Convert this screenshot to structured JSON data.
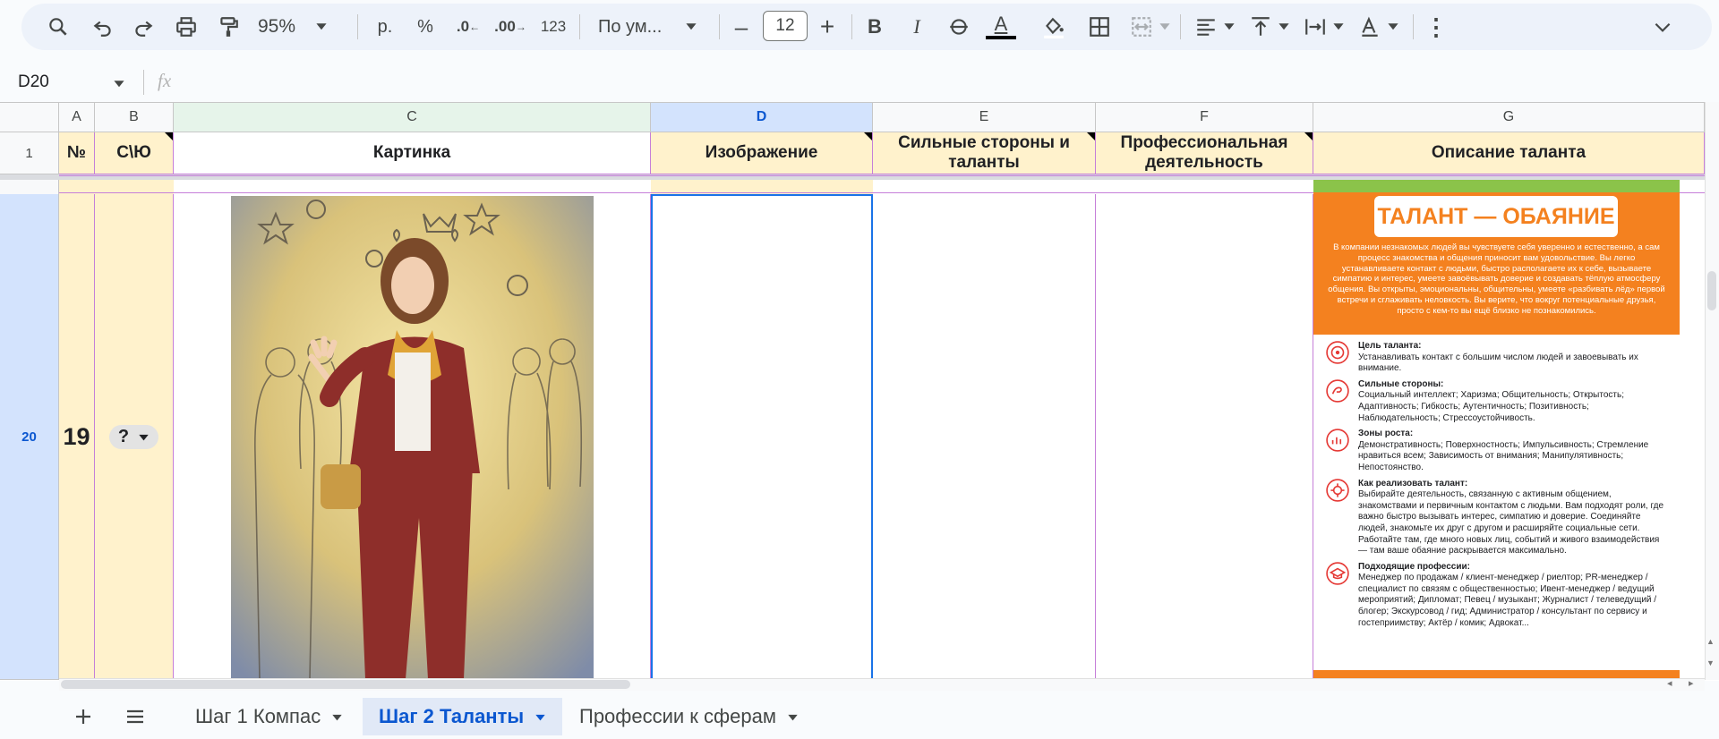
{
  "toolbar": {
    "zoom": "95%",
    "currency": "р.",
    "percent": "%",
    "dec_less": ".0",
    "dec_more": ".00",
    "number_format": "123",
    "font_name": "По ум...",
    "font_size": "12",
    "minus": "–",
    "plus": "+",
    "bold": "B",
    "italic": "I",
    "text_color": "A",
    "more": "⋮"
  },
  "formula_bar": {
    "cell_ref": "D20",
    "fx": "fx",
    "value": ""
  },
  "columns": [
    "A",
    "B",
    "C",
    "D",
    "E",
    "F",
    "G"
  ],
  "header_row": {
    "row_number": "1",
    "cells": [
      "№",
      "С\\Ю",
      "Картинка",
      "Изображение",
      "Сильные стороны и таланты",
      "Профессиональная деятельность",
      "Описание таланта"
    ]
  },
  "row20": {
    "row_number": "20",
    "num": "19",
    "chip": "?"
  },
  "talent_card": {
    "title": "ТАЛАНТ — ОБАЯНИЕ",
    "intro": "В компании незнакомых людей вы чувствуете себя уверенно и естественно, а сам процесс знакомства и общения приносит вам удовольствие. Вы легко устанавливаете контакт с людьми, быстро располагаете их к себе, вызываете симпатию и интерес, умеете завоёвывать доверие и создавать тёплую атмосферу общения. Вы открыты, эмоциональны, общительны, умеете «разбивать лёд» первой встречи и сглаживать неловкость. Вы верите, что вокруг потенциальные друзья, просто с кем-то вы ещё близко не познакомились.",
    "sections": [
      {
        "heading": "Цель таланта:",
        "text": "Устанавливать контакт с большим числом людей и завоевывать их внимание."
      },
      {
        "heading": "Сильные стороны:",
        "text": "Социальный интеллект; Харизма; Общительность; Открытость; Адаптивность; Гибкость; Аутентичность; Позитивность; Наблюдательность; Стрессоустойчивость."
      },
      {
        "heading": "Зоны роста:",
        "text": "Демонстративность; Поверхностность; Импульсивность; Стремление нравиться всем; Зависимость от внимания; Манипулятивность; Непостоянство."
      },
      {
        "heading": "Как реализовать талант:",
        "text": "Выбирайте деятельность, связанную с активным общением, знакомствами и первичным контактом с людьми. Вам подходят роли, где важно быстро вызывать интерес, симпатию и доверие. Соединяйте людей, знакомьте их друг с другом и расширяйте социальные сети. Работайте там, где много новых лиц, событий и живого взаимодействия — там ваше обаяние раскрывается максимально."
      },
      {
        "heading": "Подходящие профессии:",
        "text": "Менеджер по продажам / клиент-менеджер / риелтор; PR-менеджер / специалист по связям с общественностью; Ивент-менеджер / ведущий мероприятий; Дипломат; Певец / музыкант; Журналист / телеведущий / блогер; Экскурсовод / гид; Администратор / консультант по сервису и гостеприимству; Актёр / комик; Адвокат..."
      }
    ]
  },
  "sheet_tabs": [
    "Шаг 1 Компас",
    "Шаг 2 Таланты",
    "Профессии к сферам"
  ],
  "active_tab": 1,
  "colors": {
    "header_fill": "#fff2cc",
    "selected": "#1a73e8",
    "card_orange": "#f4811f",
    "card_green": "#8bc34a",
    "border_purple": "#c67fd9"
  }
}
